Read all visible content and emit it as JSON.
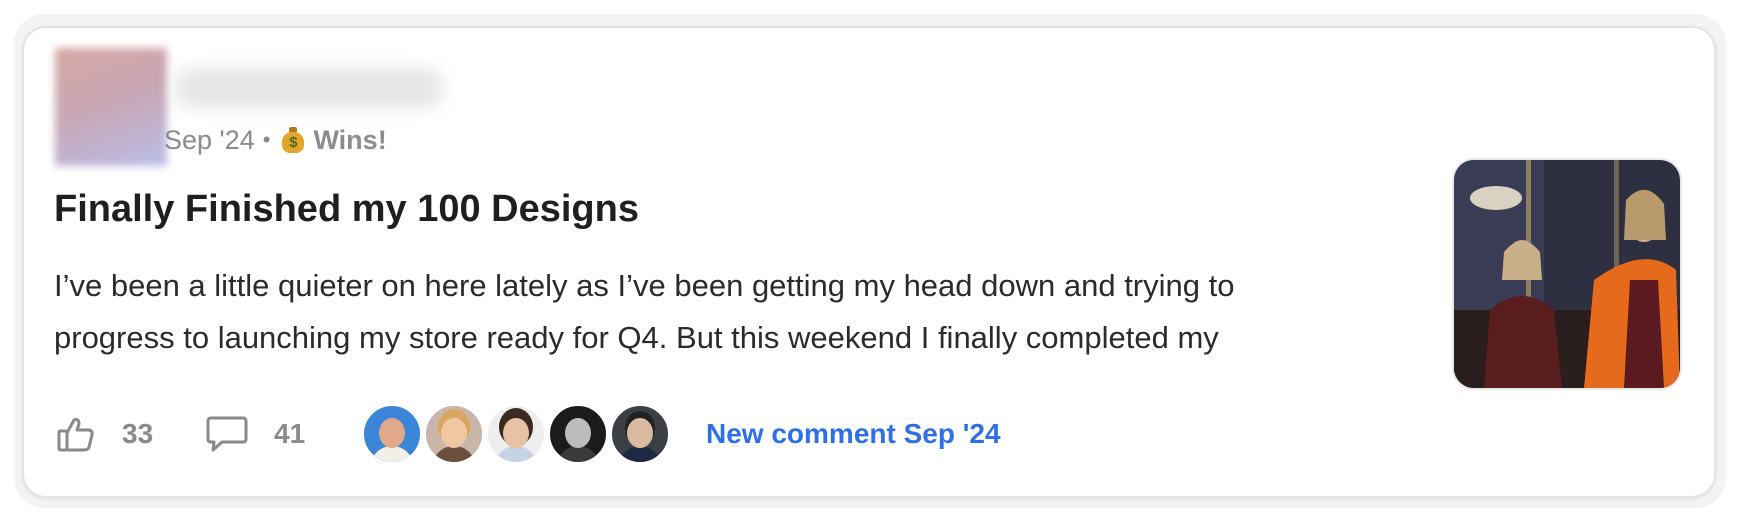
{
  "post": {
    "date": "Sep '24",
    "separator": "•",
    "category_icon": "money-bag-icon",
    "category": "Wins!",
    "title": "Finally Finished my 100 Designs",
    "excerpt": "I’ve been a little quieter on here lately as I’ve been getting my head down and trying to progress to launching my store ready for Q4. But this weekend I finally completed my"
  },
  "actions": {
    "like_icon": "thumbs-up-icon",
    "like_count": "33",
    "comment_icon": "comment-bubble-icon",
    "comment_count": "41",
    "new_comment_label": "New comment Sep '24"
  },
  "colors": {
    "accent_link": "#2f6fe8",
    "muted_text": "#8a8a8a",
    "title_text": "#1f1f1f"
  }
}
